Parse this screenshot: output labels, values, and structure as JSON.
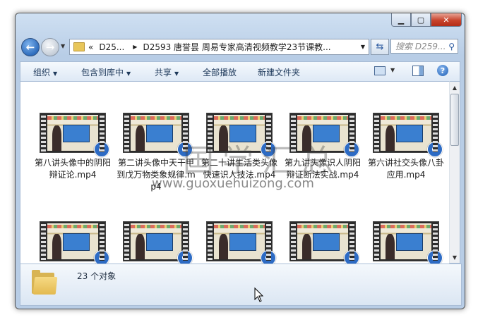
{
  "window": {
    "controls": {
      "minimize_icon": "minimize-icon",
      "maximize_icon": "maximize-icon",
      "close_icon": "close-icon"
    }
  },
  "navigation": {
    "back_icon": "back-arrow-icon",
    "forward_icon": "forward-arrow-icon",
    "address": {
      "chevron": "«",
      "crumb1": "D25...",
      "crumb2": "D2593 唐誉昙 周易专家高清视频教学23节课教..."
    },
    "search_placeholder": "搜索 D259..."
  },
  "toolbar": {
    "organize": "组织",
    "include_in_library": "包含到库中",
    "share": "共享",
    "play_all": "全部播放",
    "new_folder": "新建文件夹"
  },
  "files": [
    {
      "name": "第八讲头像中的阴阳辩证论.mp4"
    },
    {
      "name": "第二讲头像中天干甲到戊万物类象规律.mp4"
    },
    {
      "name": "第二十讲生活类头像快速识人技法.mp4"
    },
    {
      "name": "第九讲头像识人阴阳辩证断法实战.mp4"
    },
    {
      "name": "第六讲社交头像八卦应用.mp4"
    },
    {
      "name": ""
    },
    {
      "name": ""
    },
    {
      "name": ""
    },
    {
      "name": ""
    },
    {
      "name": ""
    }
  ],
  "watermark": {
    "big": "国学汇总",
    "url": "www.guoxuehuizong.com"
  },
  "details": {
    "count": "23 个对象"
  }
}
